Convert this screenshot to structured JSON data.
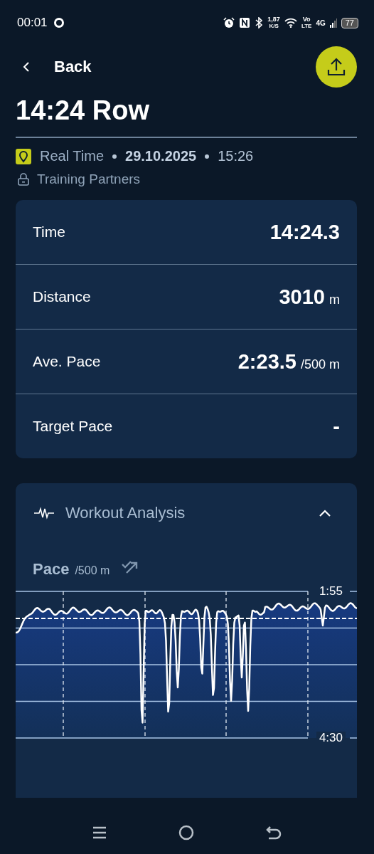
{
  "status_bar": {
    "time": "00:01",
    "net_speed": "1,87",
    "net_unit": "K/S",
    "volte_top": "Vo",
    "volte_bottom": "LTE",
    "network": "4G",
    "battery": "77"
  },
  "header": {
    "back": "Back",
    "title": "14:24 Row"
  },
  "meta": {
    "mode": "Real Time",
    "date": "29.10.2025",
    "time": "15:26",
    "privacy": "Training Partners"
  },
  "stats": [
    {
      "label": "Time",
      "value": "14:24.3"
    },
    {
      "label": "Distance",
      "value": "3010",
      "unit": "m"
    },
    {
      "label": "Ave. Pace",
      "value": "2:23.5",
      "unit": "/500 m"
    },
    {
      "label": "Target Pace",
      "value": "-"
    }
  ],
  "analysis": {
    "title": "Workout Analysis",
    "expanded": true,
    "chart_title": "Pace",
    "chart_unit": "/500 m",
    "y_top": "1:55",
    "y_bottom": "4:30"
  }
}
